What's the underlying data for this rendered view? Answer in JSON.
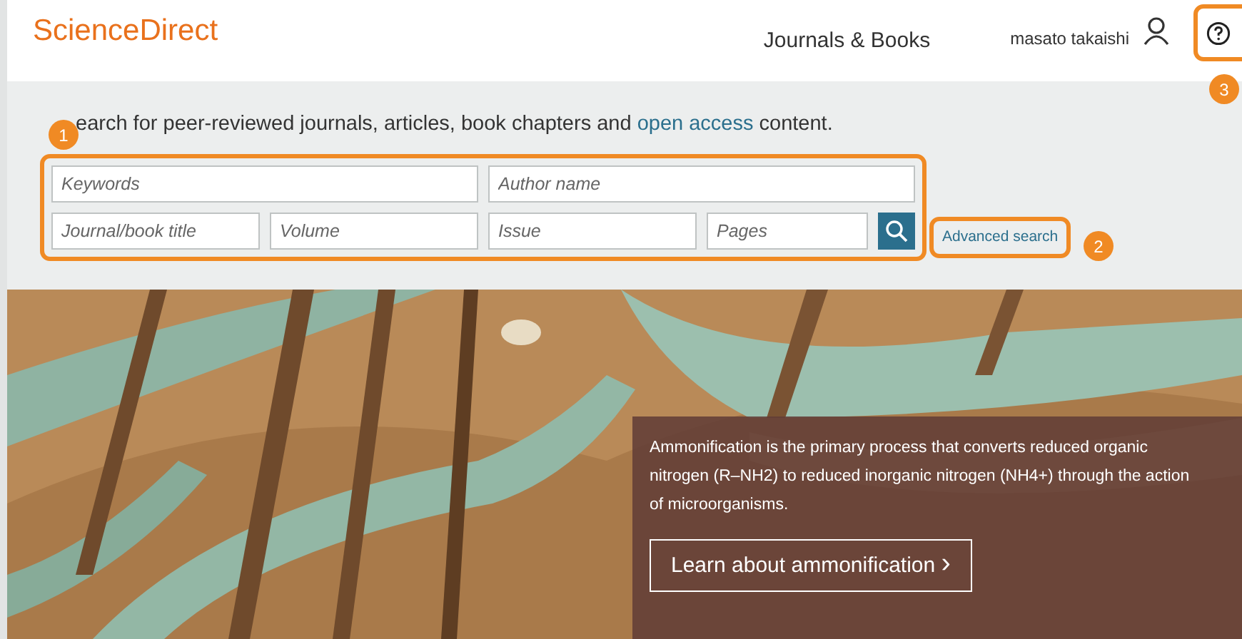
{
  "header": {
    "logo": "ScienceDirect",
    "nav_link": "Journals & Books",
    "user_name": "masato takaishi"
  },
  "search": {
    "intro": "earch for peer-reviewed journals, articles, book chapters and ",
    "intro_link": "open access",
    "intro_end": " content.",
    "fields_row_1": [
      {
        "placeholder": "Keywords"
      },
      {
        "placeholder": "Author name"
      }
    ],
    "fields_row_2": [
      {
        "placeholder": "Journal/book title"
      },
      {
        "placeholder": "Volume"
      },
      {
        "placeholder": "Issue"
      },
      {
        "placeholder": "Pages"
      }
    ],
    "advanced_link": "Advanced search"
  },
  "hero": {
    "kind": "picture",
    "caption": "Ammonification is the primary process that converts reduced organic nitrogen (R–NH2) to reduced inorganic nitrogen (NH4+) through the action of microorganisms.",
    "button": "Learn about ammonification",
    "button_arrow": "›"
  },
  "annotations": [
    "1",
    "2",
    "3"
  ]
}
